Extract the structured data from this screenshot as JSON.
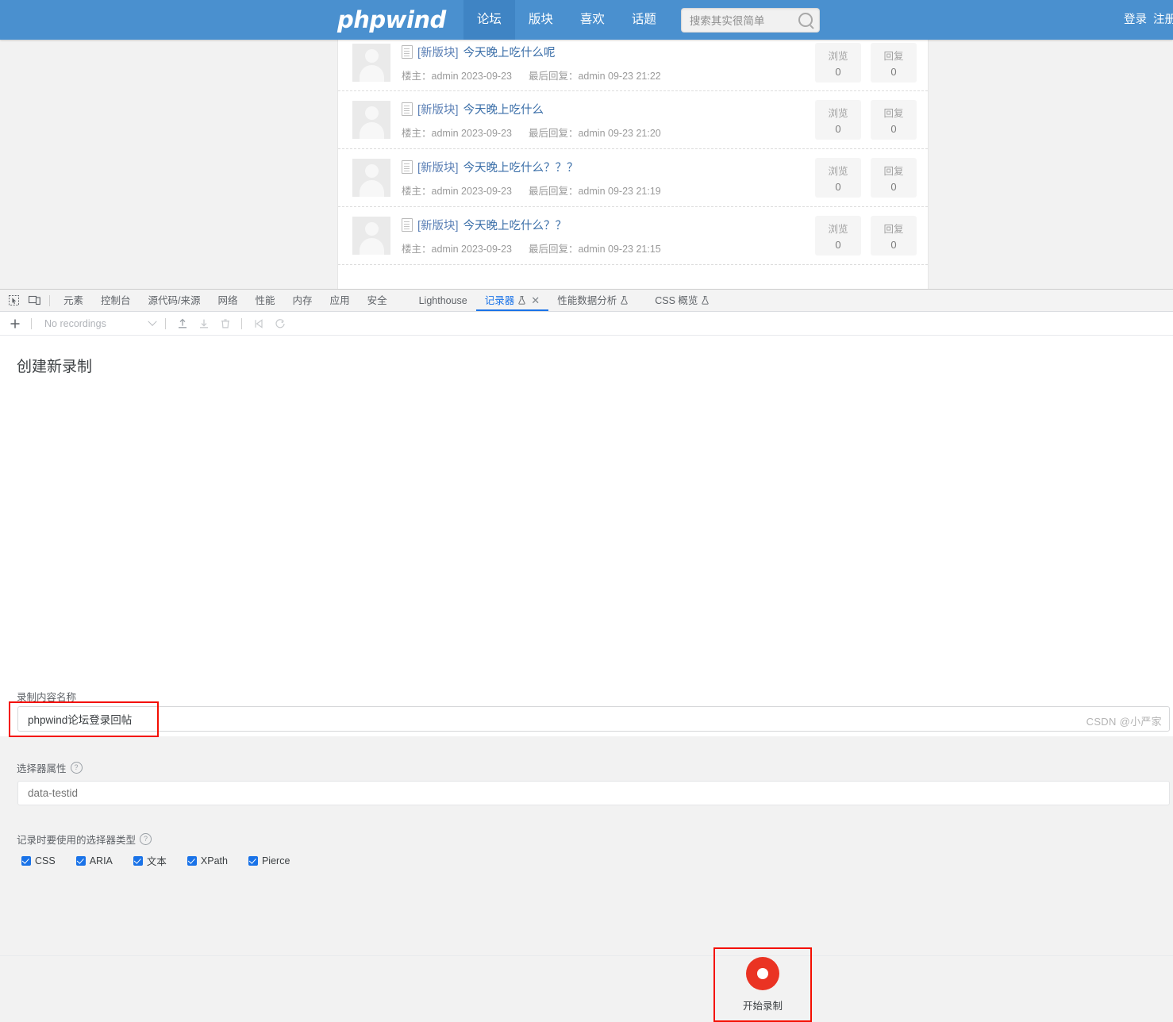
{
  "site": {
    "logo": "phpwind",
    "nav": [
      {
        "label": "论坛",
        "active": true
      },
      {
        "label": "版块",
        "active": false
      },
      {
        "label": "喜欢",
        "active": false
      },
      {
        "label": "话题",
        "active": false
      }
    ],
    "search": {
      "placeholder": "搜索其实很简单",
      "icon": "search-icon"
    },
    "auth": {
      "login": "登录",
      "register": "注册"
    },
    "thread_meta": {
      "author_label": "楼主：",
      "lastreply_label": "最后回复：",
      "views_label": "浏览",
      "replies_label": "回复"
    },
    "threads": [
      {
        "tag": "[新版块]",
        "title": "今天晚上吃什么呢",
        "author": "admin",
        "date": "2023-09-23",
        "last_author": "admin",
        "last_time": "09-23 21:22",
        "views": "0",
        "replies": "0"
      },
      {
        "tag": "[新版块]",
        "title": "今天晚上吃什么",
        "author": "admin",
        "date": "2023-09-23",
        "last_author": "admin",
        "last_time": "09-23 21:20",
        "views": "0",
        "replies": "0"
      },
      {
        "tag": "[新版块]",
        "title": "今天晚上吃什么？？？",
        "author": "admin",
        "date": "2023-09-23",
        "last_author": "admin",
        "last_time": "09-23 21:19",
        "views": "0",
        "replies": "0"
      },
      {
        "tag": "[新版块]",
        "title": "今天晚上吃什么？？",
        "author": "admin",
        "date": "2023-09-23",
        "last_author": "admin",
        "last_time": "09-23 21:15",
        "views": "0",
        "replies": "0"
      }
    ]
  },
  "devtools": {
    "left_icons": [
      {
        "name": "inspect-element-icon"
      },
      {
        "name": "device-toolbar-icon"
      }
    ],
    "tabs": [
      {
        "label": "元素",
        "active": false,
        "experimental": false,
        "closable": false
      },
      {
        "label": "控制台",
        "active": false,
        "experimental": false,
        "closable": false
      },
      {
        "label": "源代码/来源",
        "active": false,
        "experimental": false,
        "closable": false
      },
      {
        "label": "网络",
        "active": false,
        "experimental": false,
        "closable": false
      },
      {
        "label": "性能",
        "active": false,
        "experimental": false,
        "closable": false
      },
      {
        "label": "内存",
        "active": false,
        "experimental": false,
        "closable": false
      },
      {
        "label": "应用",
        "active": false,
        "experimental": false,
        "closable": false
      },
      {
        "label": "安全",
        "active": false,
        "experimental": false,
        "closable": false
      },
      {
        "label": "Lighthouse",
        "active": false,
        "experimental": false,
        "closable": false
      },
      {
        "label": "记录器",
        "active": true,
        "experimental": true,
        "closable": true
      },
      {
        "label": "性能数据分析",
        "active": false,
        "experimental": true,
        "closable": false
      },
      {
        "label": "CSS 概览",
        "active": false,
        "experimental": true,
        "closable": false
      }
    ],
    "toolbar": {
      "add_label": "+",
      "recordings_select": "No recordings",
      "buttons": [
        {
          "name": "add-recording-button",
          "icon": "plus-icon"
        },
        {
          "name": "import-recording-button",
          "icon": "upload-icon"
        },
        {
          "name": "export-recording-button",
          "icon": "download-icon"
        },
        {
          "name": "delete-recording-button",
          "icon": "trash-icon"
        },
        {
          "name": "replay-button",
          "icon": "play-icon"
        },
        {
          "name": "performance-replay-button",
          "icon": "refresh-icon"
        }
      ]
    },
    "recorder": {
      "heading": "创建新录制",
      "name_label": "录制内容名称",
      "name_value": "phpwind论坛登录回帖",
      "selector_attr_label": "选择器属性",
      "selector_attr_placeholder": "data-testid",
      "selector_types_label": "记录时要使用的选择器类型",
      "selector_types": [
        {
          "label": "CSS",
          "checked": true
        },
        {
          "label": "ARIA",
          "checked": true
        },
        {
          "label": "文本",
          "checked": true
        },
        {
          "label": "XPath",
          "checked": true
        },
        {
          "label": "Pierce",
          "checked": true
        }
      ],
      "start_button": "开始录制",
      "help_icon": "question-mark-icon",
      "record_icon": "record-circle-icon"
    }
  },
  "watermark": "CSDN @小严家",
  "colors": {
    "nav_blue": "#4a90cf",
    "nav_active_blue": "#3f84c4",
    "link_blue": "#3a6ea8",
    "devtools_accent": "#1a73e8",
    "record_red": "#ea3323",
    "highlight_red": "#f40f02",
    "page_bg": "#f2f2f2"
  }
}
